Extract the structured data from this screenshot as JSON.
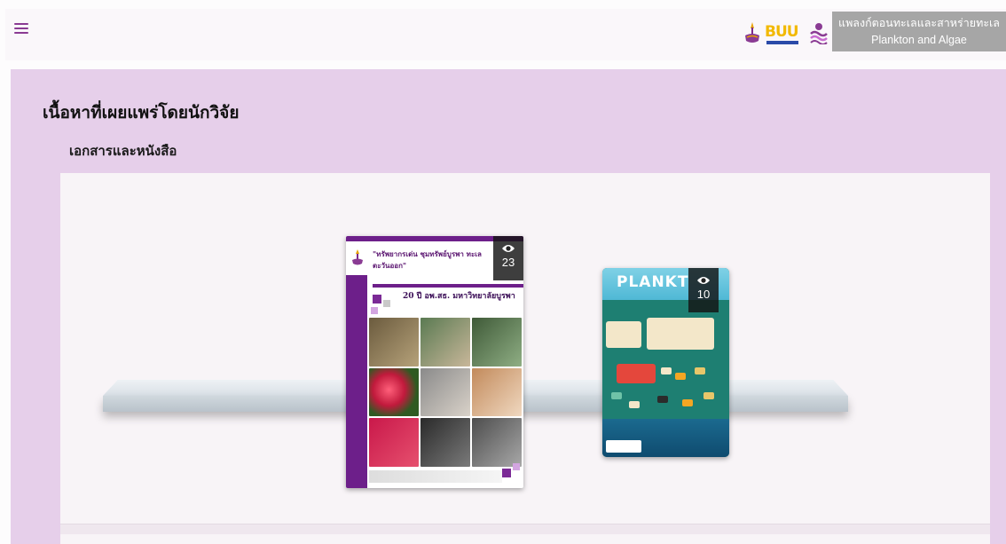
{
  "header": {
    "menu_icon": "hamburger-menu-icon",
    "logo_text": "BUU",
    "app_title_line1": "แพลงก์ตอนทะเลและสาหร่ายทะเล",
    "app_title_line2": "Plankton and Algae"
  },
  "main": {
    "heading": "เนื้อหาที่เผยแพร่โดยนักวิจัย",
    "subheading": "เอกสารและหนังสือ"
  },
  "books": [
    {
      "title": "\"ทรัพยากรเด่น ชุมทรัพย์บูรพา ทะเลตะวันออก\"",
      "subtitle": "20 ปี อพ.สธ. มหาวิทยาลัยบูรพา",
      "views": "23",
      "view_icon": "eye-icon"
    },
    {
      "title": "PLANKT",
      "views": "10",
      "view_icon": "eye-icon"
    }
  ],
  "colors": {
    "accent": "#8a3b93",
    "content_bg": "#e6cfea",
    "title_bg": "#a6a6a6"
  }
}
